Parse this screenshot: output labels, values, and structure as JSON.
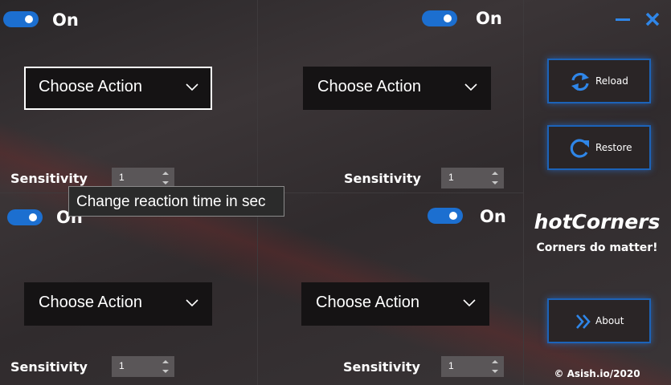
{
  "colors": {
    "accent": "#1c6fd0",
    "background": "#332e30",
    "dropdown_bg": "#151314",
    "spinner_bg": "#5a5658"
  },
  "corners": {
    "top_left": {
      "toggle_label": "On",
      "toggle_on": true,
      "action": "Choose Action",
      "sensitivity_label": "Sensitivity",
      "sensitivity_value": "1"
    },
    "top_right": {
      "toggle_label": "On",
      "toggle_on": true,
      "action": "Choose Action",
      "sensitivity_label": "Sensitivity",
      "sensitivity_value": "1"
    },
    "bottom_left": {
      "toggle_label": "On",
      "toggle_on": true,
      "action": "Choose Action",
      "sensitivity_label": "Sensitivity",
      "sensitivity_value": "1"
    },
    "bottom_right": {
      "toggle_label": "On",
      "toggle_on": true,
      "action": "Choose Action",
      "sensitivity_label": "Sensitivity",
      "sensitivity_value": "1"
    }
  },
  "tooltip": {
    "text": "Change reaction time in sec"
  },
  "sidebar": {
    "reload_label": "Reload",
    "restore_label": "Restore",
    "app_title": "hotCorners",
    "tagline": "Corners do matter!",
    "about_label": "About",
    "copyright": "© Asish.io/2020"
  },
  "icons": {
    "minimize": "minimize-icon",
    "close": "close-icon",
    "reload": "reload-icon",
    "restore": "restore-icon",
    "about": "double-chevron-right-icon",
    "dropdown": "chevron-down-icon",
    "spin_up": "spin-up-icon",
    "spin_down": "spin-down-icon"
  }
}
